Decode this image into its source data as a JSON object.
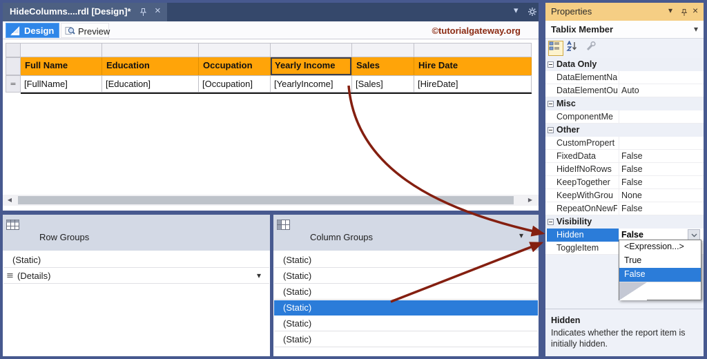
{
  "window": {
    "tab_title": "HideColumns....rdl [Design]*",
    "watermark": "©tutorialgateway.org"
  },
  "toolbar": {
    "design_label": "Design",
    "preview_label": "Preview"
  },
  "table": {
    "columns": [
      {
        "header": "Full Name",
        "field": "[FullName]"
      },
      {
        "header": "Education",
        "field": "[Education]"
      },
      {
        "header": "Occupation",
        "field": "[Occupation]"
      },
      {
        "header": "Yearly Income",
        "field": "[YearlyIncome]"
      },
      {
        "header": "Sales",
        "field": "[Sales]"
      },
      {
        "header": "Hire Date",
        "field": "[HireDate]"
      }
    ],
    "selected_column": "Yearly Income"
  },
  "groups": {
    "row_groups": {
      "title": "Row Groups",
      "items": [
        "(Static)",
        "(Details)"
      ]
    },
    "column_groups": {
      "title": "Column Groups",
      "items": [
        "(Static)",
        "(Static)",
        "(Static)",
        "(Static)",
        "(Static)",
        "(Static)"
      ],
      "selected_index": 3
    }
  },
  "properties": {
    "panel_title": "Properties",
    "object_selector": "Tablix Member",
    "rows": [
      {
        "type": "category",
        "label": "Data Only"
      },
      {
        "type": "property",
        "label": "DataElementNa",
        "value": ""
      },
      {
        "type": "property",
        "label": "DataElementOu",
        "value": "Auto"
      },
      {
        "type": "category",
        "label": "Misc"
      },
      {
        "type": "property",
        "label": "ComponentMe",
        "value": ""
      },
      {
        "type": "category",
        "label": "Other"
      },
      {
        "type": "property",
        "label": "CustomPropert",
        "value": ""
      },
      {
        "type": "property",
        "label": "FixedData",
        "value": "False"
      },
      {
        "type": "property",
        "label": "HideIfNoRows",
        "value": "False"
      },
      {
        "type": "property",
        "label": "KeepTogether",
        "value": "False"
      },
      {
        "type": "property",
        "label": "KeepWithGrou",
        "value": "None"
      },
      {
        "type": "property",
        "label": "RepeatOnNewP",
        "value": "False"
      },
      {
        "type": "category",
        "label": "Visibility"
      },
      {
        "type": "property",
        "label": "Hidden",
        "value": "False",
        "selected": true
      },
      {
        "type": "property",
        "label": "ToggleItem",
        "value": ""
      }
    ],
    "dropdown": {
      "options": [
        "<Expression...>",
        "True",
        "False"
      ],
      "selected": "False"
    },
    "description": {
      "title": "Hidden",
      "text": "Indicates whether the report item is initially hidden."
    }
  },
  "icons": {
    "caret": "▾",
    "close": "×",
    "scroll_left": "◀",
    "scroll_right": "▶",
    "details_handle": "≡",
    "row_handle": "="
  },
  "colors": {
    "frame_blue": "#47598F",
    "tabbar_blue": "#35486B",
    "header_orange": "#FFA409",
    "selection_blue": "#2B7CD9",
    "properties_titlebar": "#F5CE84",
    "arrow_red": "#841F10",
    "watermark_red": "#8B2A12"
  }
}
